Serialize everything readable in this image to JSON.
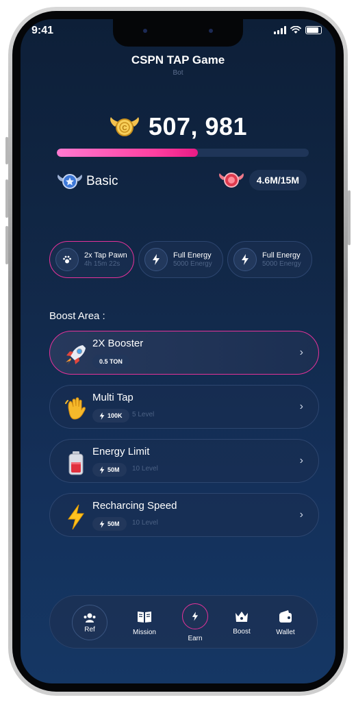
{
  "status": {
    "time": "9:41"
  },
  "header": {
    "title": "CSPN TAP Game",
    "subtitle": "Bot"
  },
  "balance": {
    "amount": "507, 981",
    "progress_fraction": 0.56
  },
  "level": {
    "name": "Basic"
  },
  "energy": {
    "value": "4.6M/15M"
  },
  "chips": [
    {
      "title": "2x Tap Pawn",
      "sub": "4h 15m 22s",
      "icon": "paw-icon"
    },
    {
      "title": "Full Energy",
      "sub": "5000 Energy",
      "icon": "bolt-icon"
    },
    {
      "title": "Full Energy",
      "sub": "5000 Energy",
      "icon": "bolt-icon"
    }
  ],
  "boost_area": {
    "title": "Boost Area :",
    "items": [
      {
        "name": "2X Booster",
        "price": "0.5 TON",
        "level": "",
        "icon": "rocket-icon"
      },
      {
        "name": "Multi Tap",
        "price": "100K",
        "level": "5 Level",
        "icon": "waving-hand-icon"
      },
      {
        "name": "Energy Limit",
        "price": "50M",
        "level": "10 Level",
        "icon": "battery-icon"
      },
      {
        "name": "Recharcing Speed",
        "price": "50M",
        "level": "10 Level",
        "icon": "lightning-icon"
      }
    ]
  },
  "nav": {
    "items": [
      {
        "label": "Ref",
        "icon": "people-icon"
      },
      {
        "label": "Mission",
        "icon": "book-icon"
      },
      {
        "label": "Earn",
        "icon": "bolt-icon"
      },
      {
        "label": "Boost",
        "icon": "crown-icon"
      },
      {
        "label": "Wallet",
        "icon": "wallet-icon"
      }
    ]
  },
  "colors": {
    "accent_pink": "#e6329a",
    "bg": "#112746"
  }
}
